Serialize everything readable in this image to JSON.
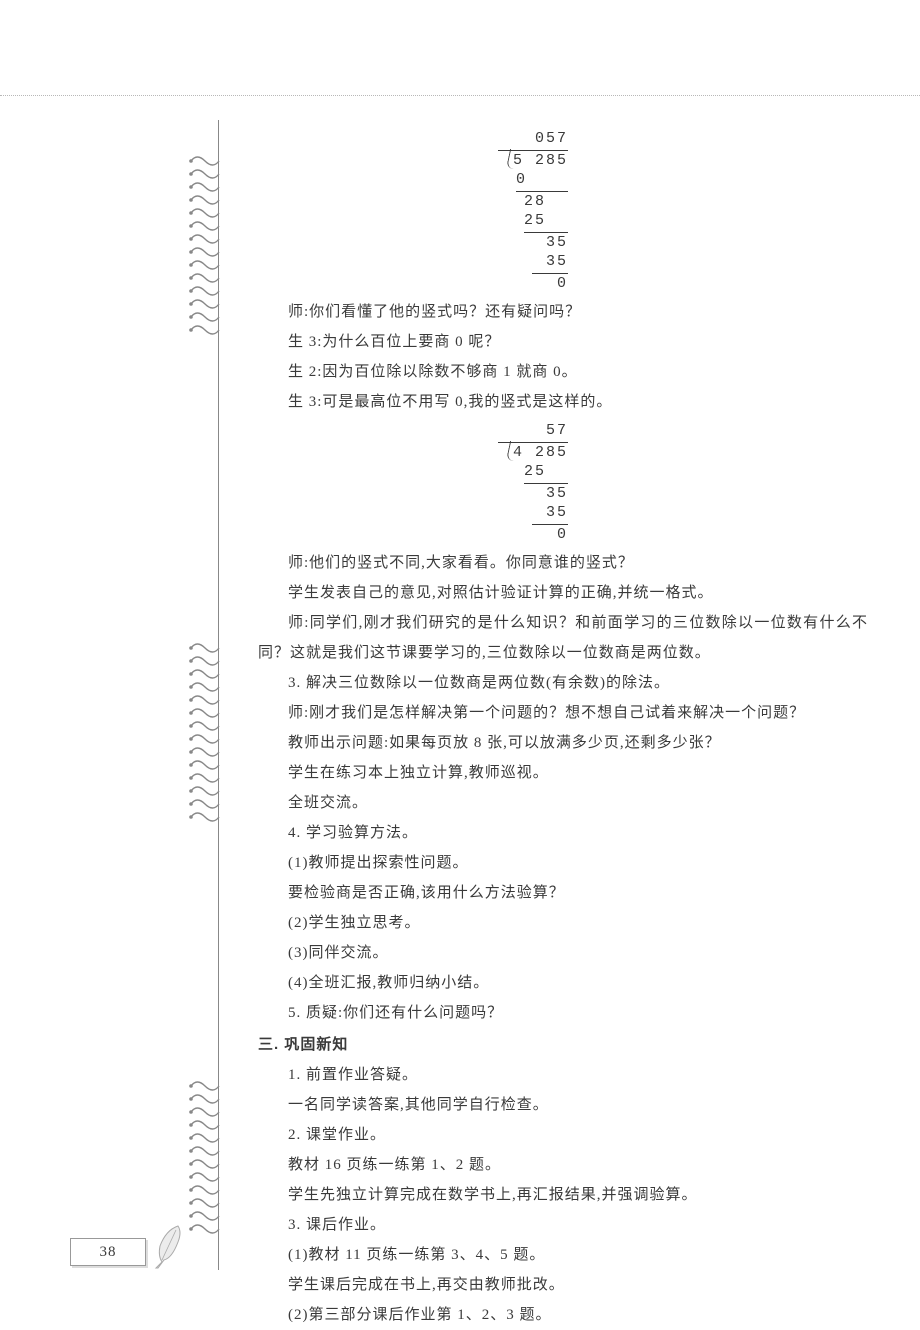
{
  "page_number": "38",
  "division1": {
    "quotient": "057",
    "divisor": "5",
    "dividend": "285",
    "steps": [
      "0",
      "28",
      "25",
      "35",
      "35",
      "0"
    ]
  },
  "dialogue1": {
    "t1": "师:你们看懂了他的竖式吗？还有疑问吗？",
    "s3a": "生 3:为什么百位上要商 0 呢？",
    "s2": "生 2:因为百位除以除数不够商 1 就商 0。",
    "s3b": "生 3:可是最高位不用写 0,我的竖式是这样的。"
  },
  "division2": {
    "quotient": "57",
    "divisor": "4",
    "dividend": "285",
    "steps": [
      "25",
      "35",
      "35",
      "0"
    ]
  },
  "body": {
    "p1": "师:他们的竖式不同,大家看看。你同意谁的竖式？",
    "p2": "学生发表自己的意见,对照估计验证计算的正确,并统一格式。",
    "p3": "师:同学们,刚才我们研究的是什么知识？和前面学习的三位数除以一位数有什么不同？这就是我们这节课要学习的,三位数除以一位数商是两位数。",
    "p4": "3. 解决三位数除以一位数商是两位数(有余数)的除法。",
    "p5": "师:刚才我们是怎样解决第一个问题的？想不想自己试着来解决一个问题？",
    "p6": "教师出示问题:如果每页放 8 张,可以放满多少页,还剩多少张？",
    "p7": "学生在练习本上独立计算,教师巡视。",
    "p8": "全班交流。",
    "p9": "4. 学习验算方法。",
    "p10": "(1)教师提出探索性问题。",
    "p11": "要检验商是否正确,该用什么方法验算？",
    "p12": "(2)学生独立思考。",
    "p13": "(3)同伴交流。",
    "p14": "(4)全班汇报,教师归纳小结。",
    "p15": "5. 质疑:你们还有什么问题吗？"
  },
  "section3": {
    "heading": "三. 巩固新知",
    "p1": "1. 前置作业答疑。",
    "p2": "一名同学读答案,其他同学自行检查。",
    "p3": "2. 课堂作业。",
    "p4": "教材 16 页练一练第 1、2 题。",
    "p5": "学生先独立计算完成在数学书上,再汇报结果,并强调验算。",
    "p6": "3. 课后作业。",
    "p7": "(1)教材 11 页练一练第 3、4、5 题。",
    "p8": "学生课后完成在书上,再交由教师批改。",
    "p9": "(2)第三部分课后作业第 1、2、3 题。"
  }
}
